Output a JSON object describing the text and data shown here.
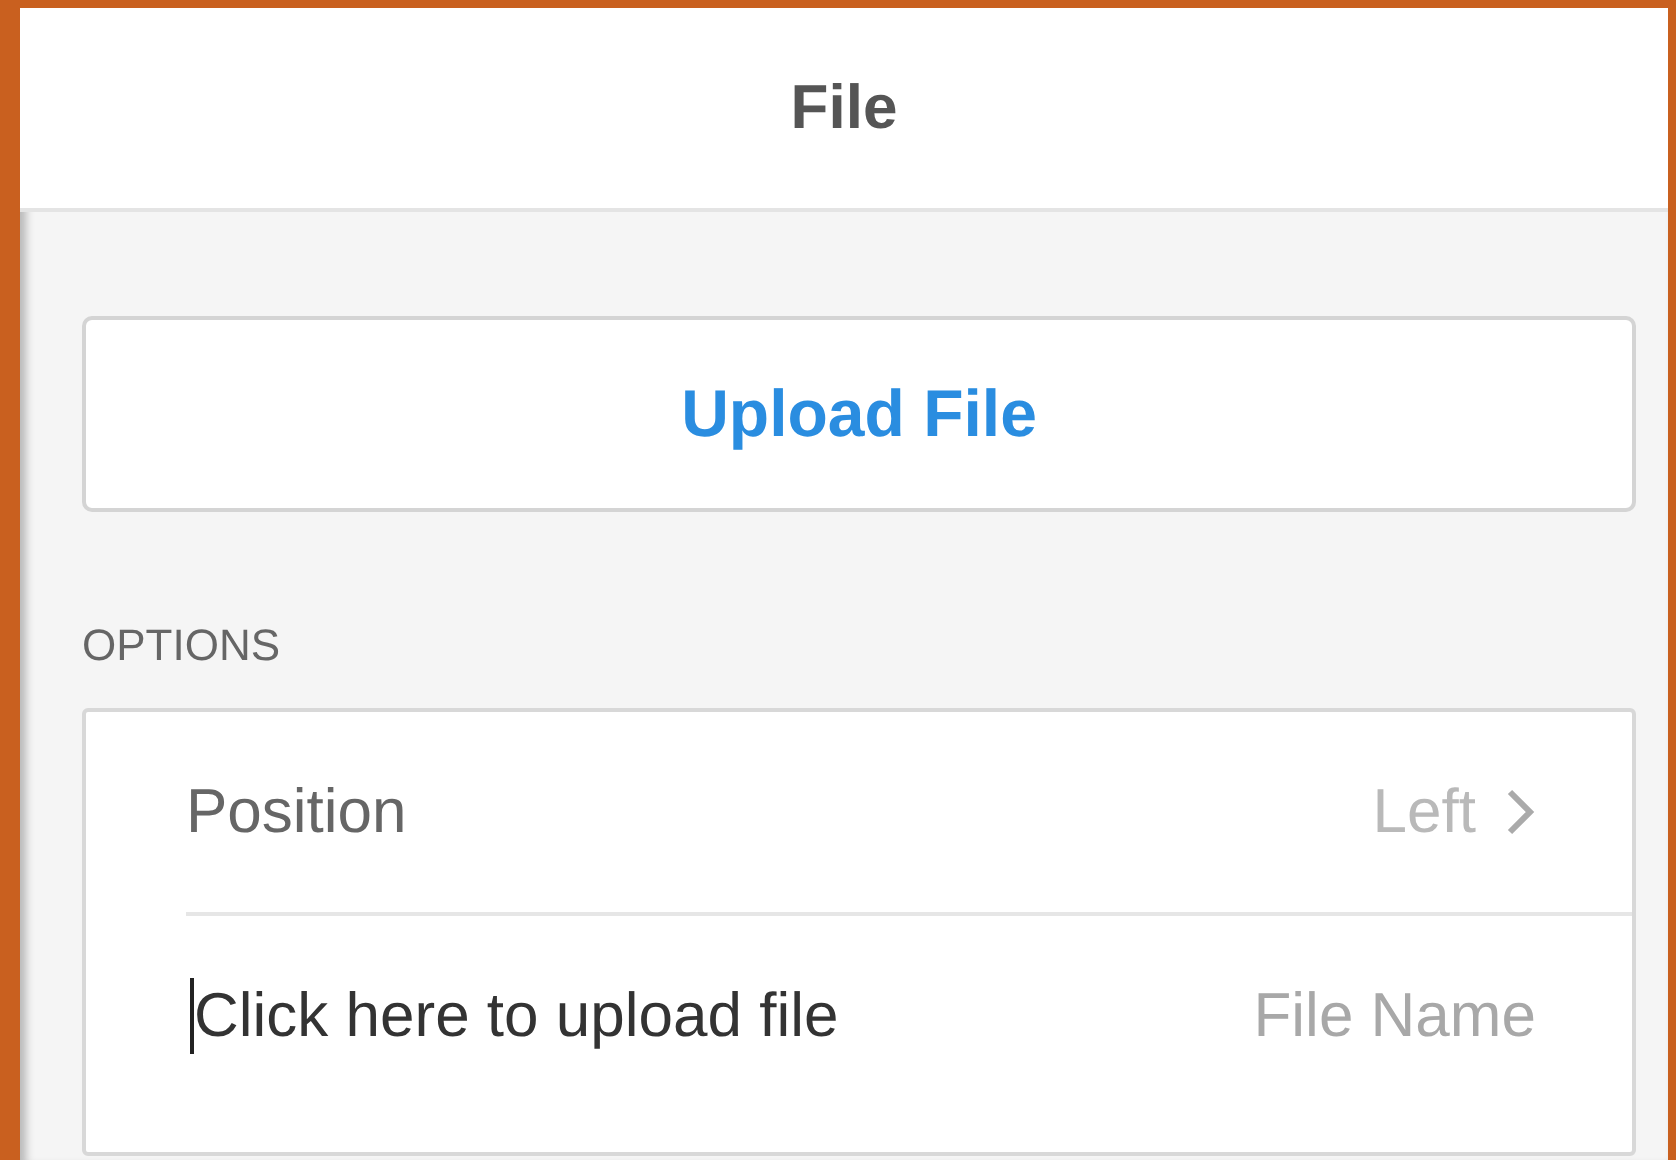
{
  "header": {
    "title": "File"
  },
  "upload_button": {
    "label": "Upload File"
  },
  "options": {
    "heading": "OPTIONS",
    "rows": [
      {
        "kind": "select",
        "label": "Position",
        "value": "Left"
      },
      {
        "kind": "input",
        "text": "Click here to upload file",
        "hint": "File Name"
      }
    ]
  }
}
